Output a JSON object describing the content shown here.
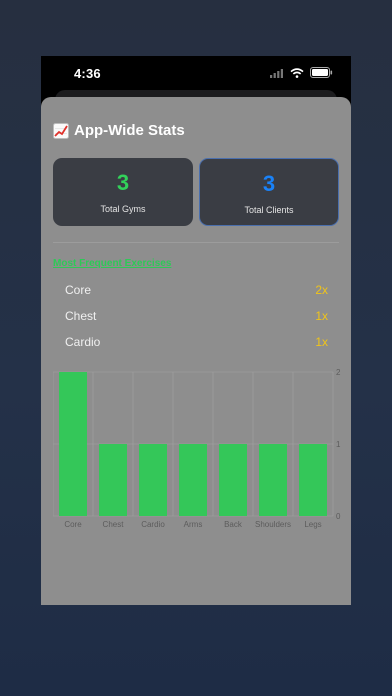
{
  "status_bar": {
    "time": "4:36",
    "icons": [
      "cellular-signal-icon",
      "wifi-icon",
      "battery-icon"
    ]
  },
  "sheet": {
    "title_icon": "chart-increasing-emoji",
    "title": "App-Wide Stats",
    "stats": [
      {
        "value": "3",
        "label": "Total Gyms",
        "color": "#32d15a"
      },
      {
        "value": "3",
        "label": "Total Clients",
        "color": "#1a82f7"
      }
    ],
    "section_title": "Most Frequent Exercises",
    "exercises": [
      {
        "name": "Core",
        "count": "2x"
      },
      {
        "name": "Chest",
        "count": "1x"
      },
      {
        "name": "Cardio",
        "count": "1x"
      }
    ]
  },
  "colors": {
    "accent_green": "#2ec957",
    "bar_green": "#34c759",
    "count_yellow": "#f0c419",
    "sheet_bg": "#8e8e8e",
    "card_bg": "#3a3d44"
  },
  "chart_data": {
    "type": "bar",
    "categories": [
      "Core",
      "Chest",
      "Cardio",
      "Arms",
      "Back",
      "Shoulders",
      "Legs"
    ],
    "values": [
      2,
      1,
      1,
      1,
      1,
      1,
      1
    ],
    "ylim": [
      0,
      2
    ],
    "yticks": [
      "0",
      "1",
      "2"
    ],
    "grid": true,
    "y_axis_side": "right"
  }
}
